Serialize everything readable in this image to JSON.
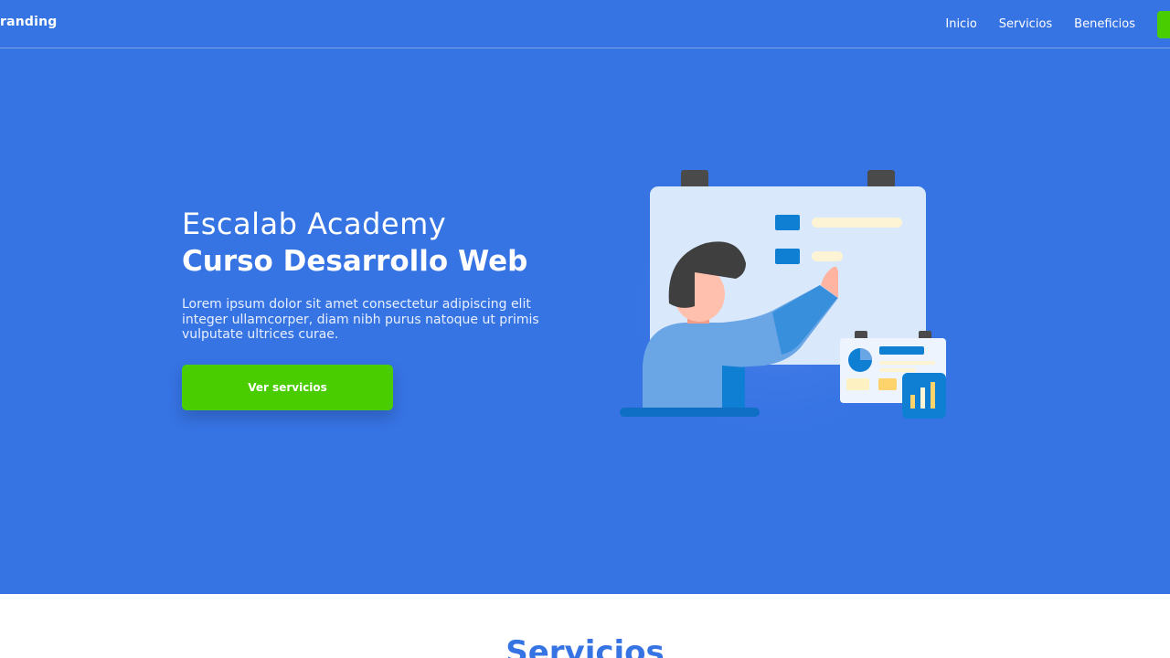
{
  "navbar": {
    "brand": "randing",
    "links": [
      "Inicio",
      "Servicios",
      "Beneficios"
    ]
  },
  "hero": {
    "title_line1": "Escalab Academy",
    "title_line2": "Curso Desarrollo Web",
    "lead": "Lorem ipsum dolor sit amet consectetur adipiscing elit integer ullamcorper, diam nibh purus natoque ut primis vulputate ultrices curae.",
    "button_label": "Ver servicios"
  },
  "services": {
    "title": "Servicios"
  },
  "colors": {
    "primary": "#3673e3",
    "accent": "#49cc00",
    "text_light": "#ffffff"
  }
}
